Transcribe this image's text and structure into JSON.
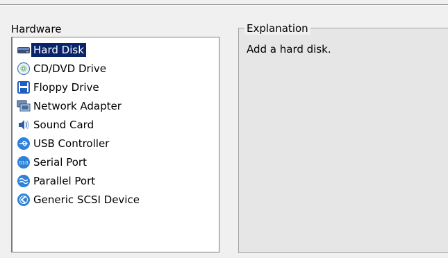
{
  "hardware": {
    "label": "Hardware",
    "items": [
      {
        "label": "Hard Disk",
        "icon": "hard-disk-icon",
        "selected": true
      },
      {
        "label": "CD/DVD Drive",
        "icon": "cd-dvd-icon"
      },
      {
        "label": "Floppy Drive",
        "icon": "floppy-icon"
      },
      {
        "label": "Network Adapter",
        "icon": "network-adapter-icon"
      },
      {
        "label": "Sound Card",
        "icon": "sound-card-icon"
      },
      {
        "label": "USB Controller",
        "icon": "usb-icon"
      },
      {
        "label": "Serial Port",
        "icon": "serial-port-icon"
      },
      {
        "label": "Parallel Port",
        "icon": "parallel-port-icon"
      },
      {
        "label": "Generic SCSI Device",
        "icon": "scsi-icon"
      }
    ]
  },
  "explanation": {
    "legend": "Explanation",
    "text": "Add a hard disk."
  },
  "colors": {
    "selection": "#0a246a",
    "panel_bg": "#e6e6e6",
    "window_bg": "#f0f0f0"
  }
}
